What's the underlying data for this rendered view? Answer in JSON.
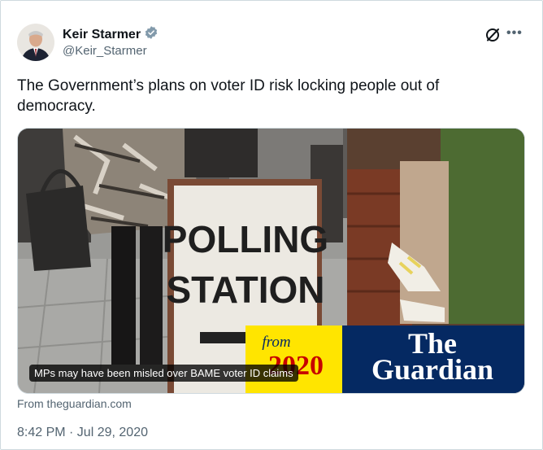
{
  "author": {
    "name": "Keir Starmer",
    "handle": "@Keir_Starmer",
    "verified_icon": "verified-badge-icon"
  },
  "tweet": {
    "text": "The Government’s plans on voter ID risk locking people out of democracy.",
    "timestamp": "8:42 PM · Jul 29, 2020"
  },
  "card": {
    "sign_line1": "POLLING",
    "sign_line2": "STATION",
    "from_label": "from",
    "year_label": "2020",
    "brand_line1": "The",
    "brand_line2": "Guardian",
    "caption": "MPs may have been misled over BAME voter ID claims",
    "source": "From theguardian.com"
  },
  "icons": {
    "grok": "grok-icon",
    "more": "more-options-icon"
  },
  "colors": {
    "text": "#0f1419",
    "secondary": "#536471",
    "verified": "#829aab",
    "guardian_blue": "#052962",
    "guardian_yellow": "#ffe500"
  }
}
